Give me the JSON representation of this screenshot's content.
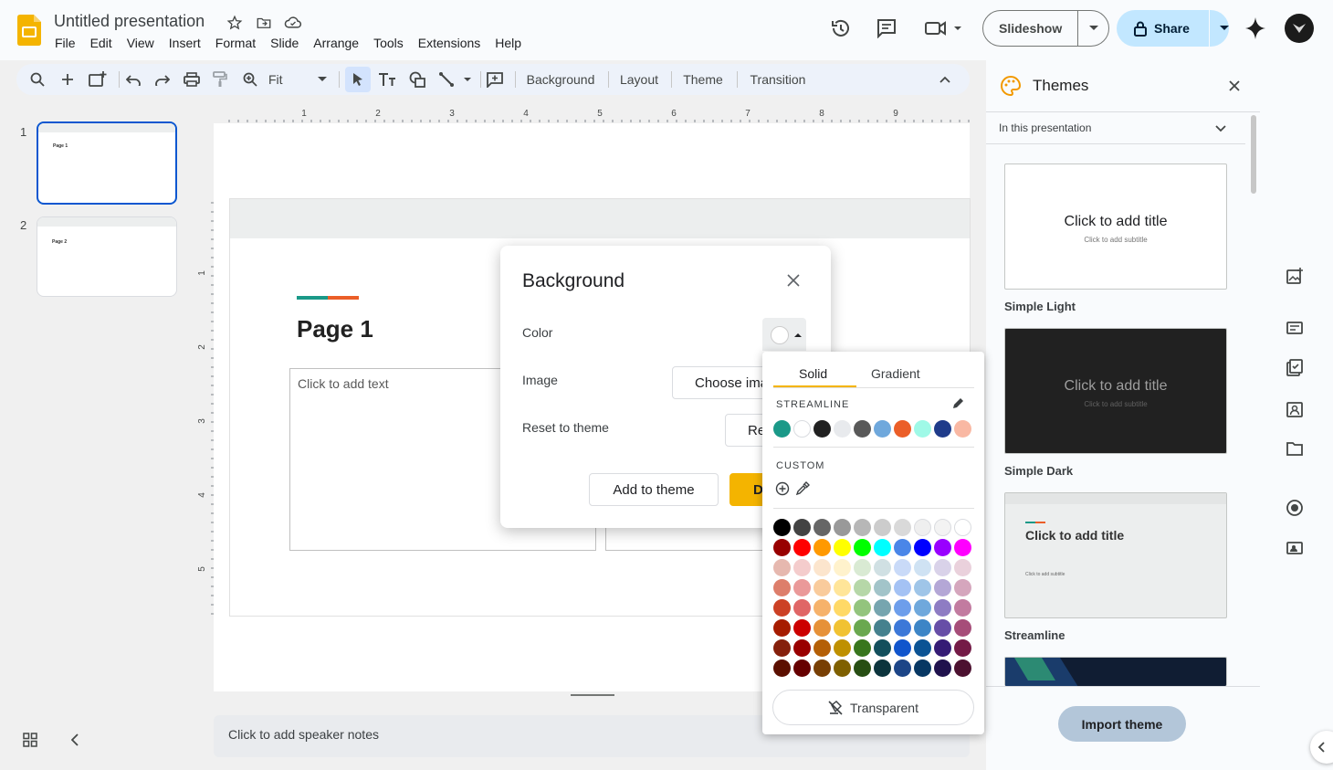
{
  "app": {
    "title": "Untitled presentation",
    "menu": [
      "File",
      "Edit",
      "View",
      "Insert",
      "Format",
      "Slide",
      "Arrange",
      "Tools",
      "Extensions",
      "Help"
    ],
    "slideshow_label": "Slideshow",
    "share_label": "Share"
  },
  "toolbar": {
    "zoom_value": "Fit",
    "background_label": "Background",
    "layout_label": "Layout",
    "theme_label": "Theme",
    "transition_label": "Transition"
  },
  "ruler": {
    "h_numbers": [
      "1",
      "2",
      "3",
      "4",
      "5",
      "6",
      "7",
      "8",
      "9"
    ],
    "v_numbers": [
      "1",
      "2",
      "3",
      "4",
      "5"
    ]
  },
  "filmstrip": {
    "slides": [
      {
        "number": "1",
        "title": "Page 1"
      },
      {
        "number": "2",
        "title": "Page 2"
      }
    ]
  },
  "slide": {
    "title": "Page 1",
    "body_placeholder": "Click to add text",
    "accent_colors": [
      "#1a9988",
      "#eb5e28"
    ]
  },
  "notes": {
    "placeholder": "Click to add speaker notes"
  },
  "dialog": {
    "title": "Background",
    "color_label": "Color",
    "image_label": "Image",
    "choose_image_label": "Choose ima",
    "reset_label": "Reset to theme",
    "reset_button_label": "Re",
    "add_to_theme_label": "Add to theme",
    "done_label": "D"
  },
  "picker": {
    "tab_solid": "Solid",
    "tab_gradient": "Gradient",
    "theme_section": "STREAMLINE",
    "theme_colors": [
      "#1a9988",
      "#ffffff",
      "#212121",
      "#e8eaed",
      "#595959",
      "#6fa8dc",
      "#eb5e28",
      "#9ff9e7",
      "#1f3b8a",
      "#f9b8a3"
    ],
    "custom_section": "CUSTOM",
    "grid": [
      [
        "#000000",
        "#434343",
        "#666666",
        "#999999",
        "#b7b7b7",
        "#cccccc",
        "#d9d9d9",
        "#efefef",
        "#f3f3f3",
        "#ffffff"
      ],
      [
        "#980000",
        "#ff0000",
        "#ff9900",
        "#ffff00",
        "#00ff00",
        "#00ffff",
        "#4a86e8",
        "#0000ff",
        "#9900ff",
        "#ff00ff"
      ],
      [
        "#e6b8af",
        "#f4cccc",
        "#fce5cd",
        "#fff2cc",
        "#d9ead3",
        "#d0e0e3",
        "#c9daf8",
        "#cfe2f3",
        "#d9d2e9",
        "#ead1dc"
      ],
      [
        "#dd7e6b",
        "#ea9999",
        "#f9cb9c",
        "#ffe599",
        "#b6d7a8",
        "#a2c4c9",
        "#a4c2f4",
        "#9fc5e8",
        "#b4a7d6",
        "#d5a6bd"
      ],
      [
        "#cc4125",
        "#e06666",
        "#f6b26b",
        "#ffd966",
        "#93c47d",
        "#76a5af",
        "#6d9eeb",
        "#6fa8dc",
        "#8e7cc3",
        "#c27ba0"
      ],
      [
        "#a61c00",
        "#cc0000",
        "#e69138",
        "#f1c232",
        "#6aa84f",
        "#45818e",
        "#3c78d8",
        "#3d85c6",
        "#674ea7",
        "#a64d79"
      ],
      [
        "#85200c",
        "#990000",
        "#b45f06",
        "#bf9000",
        "#38761d",
        "#134f5c",
        "#1155cc",
        "#0b5394",
        "#351c75",
        "#741b47"
      ],
      [
        "#5b0f00",
        "#660000",
        "#783f04",
        "#7f6000",
        "#274e13",
        "#0c343d",
        "#1c4587",
        "#073763",
        "#20124d",
        "#4c1130"
      ]
    ],
    "transparent_label": "Transparent"
  },
  "themes_panel": {
    "title": "Themes",
    "dropdown_label": "In this presentation",
    "themes": [
      {
        "name": "Simple Light",
        "title": "Click to add title",
        "subtitle": "Click to add subtitle"
      },
      {
        "name": "Simple Dark",
        "title": "Click to add title",
        "subtitle": "Click to add subtitle"
      },
      {
        "name": "Streamline",
        "title": "Click to add title",
        "subtitle": "Click to add subtitle"
      }
    ],
    "import_label": "Import theme"
  }
}
